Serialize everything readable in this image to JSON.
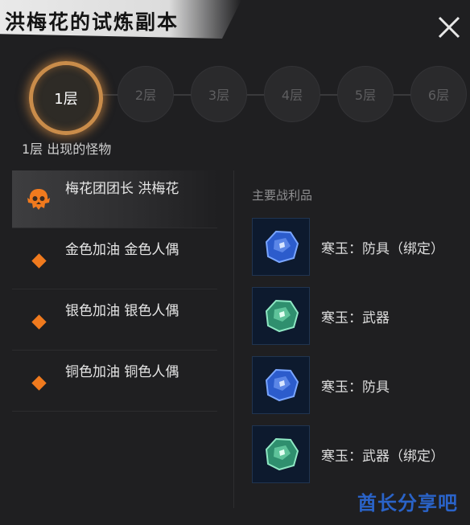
{
  "header": {
    "title": "洪梅花的试炼副本"
  },
  "floors": [
    {
      "label": "1层",
      "active": true
    },
    {
      "label": "2层",
      "active": false
    },
    {
      "label": "3层",
      "active": false
    },
    {
      "label": "4层",
      "active": false
    },
    {
      "label": "5层",
      "active": false
    },
    {
      "label": "6层",
      "active": false
    }
  ],
  "floor_caption": "1层 出现的怪物",
  "monsters": [
    {
      "name": "梅花团团长 洪梅花",
      "icon": "boss-skull-icon",
      "selected": true
    },
    {
      "name": "金色加油 金色人偶",
      "icon": "orange-diamond-icon"
    },
    {
      "name": "银色加油 银色人偶",
      "icon": "orange-diamond-icon"
    },
    {
      "name": "铜色加油 铜色人偶",
      "icon": "orange-diamond-icon"
    }
  ],
  "loot": {
    "header": "主要战利品",
    "items": [
      {
        "label": "寒玉：防具（绑定）",
        "gem_color": "#2c5ccc"
      },
      {
        "label": "寒玉：武器",
        "gem_color": "#3fae8a"
      },
      {
        "label": "寒玉：防具",
        "gem_color": "#2c5ccc"
      },
      {
        "label": "寒玉：武器（绑定）",
        "gem_color": "#3fae8a"
      }
    ]
  },
  "watermark": {
    "text": "酋长分享吧",
    "subtext": ""
  },
  "colors": {
    "accent": "#f07a1e",
    "ring": "#c98c4a",
    "background": "#1f1f21"
  }
}
